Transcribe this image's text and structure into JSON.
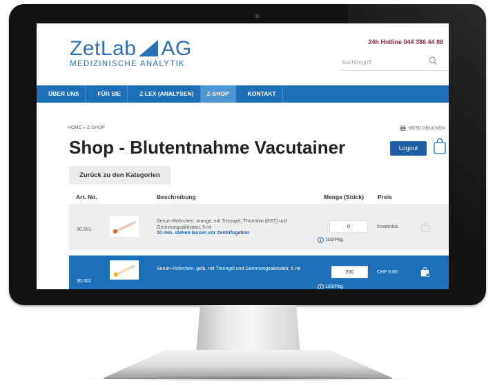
{
  "header": {
    "hotline": "24h Hotline 044 386 44 88",
    "logo_main_left": "ZetLab",
    "logo_main_right": "AG",
    "logo_sub": "MEDIZINISCHE ANALYTIK",
    "search_placeholder": "Suchbegriff"
  },
  "nav": {
    "items": [
      "ÜBER UNS",
      "FÜR SIE",
      "Z-LEX (ANALYSEN)",
      "Z-SHOP",
      "KONTAKT"
    ],
    "active": "Z-SHOP"
  },
  "breadcrumb": "HOME » Z-SHOP",
  "print_label": "SEITE DRUCKEN",
  "page_title": "Shop - Blutentnahme Vacutainer",
  "logout_label": "Logout",
  "back_label": "Zurück zu den Kategorien",
  "table": {
    "headers": {
      "art": "Art. No.",
      "desc": "Beschreibung",
      "qty": "Menge (Stück)",
      "price": "Preis"
    },
    "rows": [
      {
        "art": "30.001",
        "desc": "Serum-Röhrchen, orange, mit Trenngel, Thrombin (RST) und Gerinnungsaktivator, 5 ml",
        "note": "10 min. stehen lassen vor Zentrifugation",
        "qty": "0",
        "pkg": "100/Pkg.",
        "price": "Kostenlos",
        "tube_color": "#e0692a"
      },
      {
        "art": "30.002",
        "desc": "Serum-Röhrchen, gelb, mit Trenngel und Gerinnungsaktivator, 5 ml",
        "note": "",
        "qty": "200",
        "pkg": "100/Pkg.",
        "price": "CHF 0.00",
        "tube_color": "#f0b400"
      }
    ]
  },
  "colors": {
    "brand_blue": "#1d70b7",
    "nav_active": "#4d96d6",
    "hotline": "#8a2a4a"
  }
}
